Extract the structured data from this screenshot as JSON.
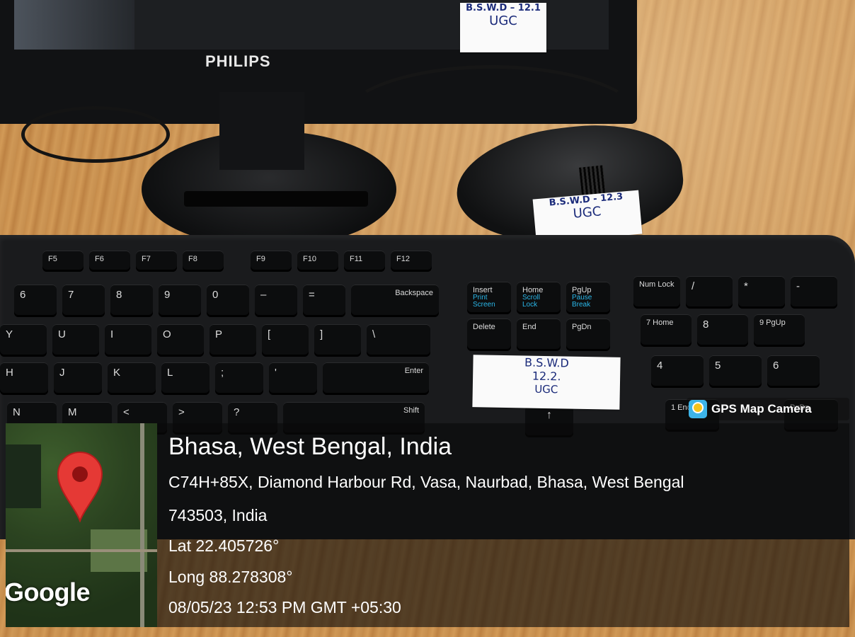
{
  "scene": {
    "monitor_brand": "PHILIPS",
    "tags": {
      "monitor": {
        "line1": "B.S.W.D – 12.1",
        "line2": "UGC"
      },
      "mouse": {
        "line1": "B.S.W.D - 12.3",
        "line2": "UGC"
      },
      "keyboard": {
        "line1": "B.S.W.D",
        "line2": "12.2.",
        "line3": "UGC"
      }
    },
    "keys": {
      "fn_row": [
        "F5",
        "F6",
        "F7",
        "F8",
        "F9",
        "F10",
        "F11",
        "F12"
      ],
      "nav_top": [
        {
          "label": "Insert",
          "sub": "Print Screen"
        },
        {
          "label": "Home",
          "sub": "Scroll Lock"
        },
        {
          "label": "PgUp",
          "sub": "Pause Break"
        }
      ],
      "nav_mid": [
        "Delete",
        "End",
        "PgDn"
      ],
      "row_num": [
        "6",
        "7",
        "8",
        "9",
        "0",
        "–",
        "=",
        "Backspace"
      ],
      "row_top": [
        "Y",
        "U",
        "I",
        "O",
        "P",
        "[",
        "]",
        "\\"
      ],
      "row_home": [
        "H",
        "J",
        "K",
        "L",
        ";",
        "'",
        "Enter"
      ],
      "row_bottom": [
        "N",
        "M",
        "<",
        ">",
        "?",
        "Shift"
      ],
      "numpad": [
        "Num Lock",
        "/",
        "*",
        "-",
        "7 Home",
        "8",
        "9 PgUp",
        "4",
        "5",
        "6",
        "1 End",
        "PgDn"
      ]
    }
  },
  "overlay": {
    "badge_text": "GPS Map Camera",
    "map_label": "Google",
    "title": "Bhasa, West Bengal, India",
    "address_line1": "C74H+85X, Diamond Harbour Rd, Vasa, Naurbad, Bhasa, West Bengal",
    "address_line2": "743503, India",
    "lat": "Lat 22.405726°",
    "long": "Long 88.278308°",
    "timestamp": "08/05/23 12:53 PM GMT +05:30"
  },
  "colors": {
    "pin": "#e53935",
    "badge_icon": "#3db4e8",
    "tag_ink": "#1b2b7a"
  }
}
